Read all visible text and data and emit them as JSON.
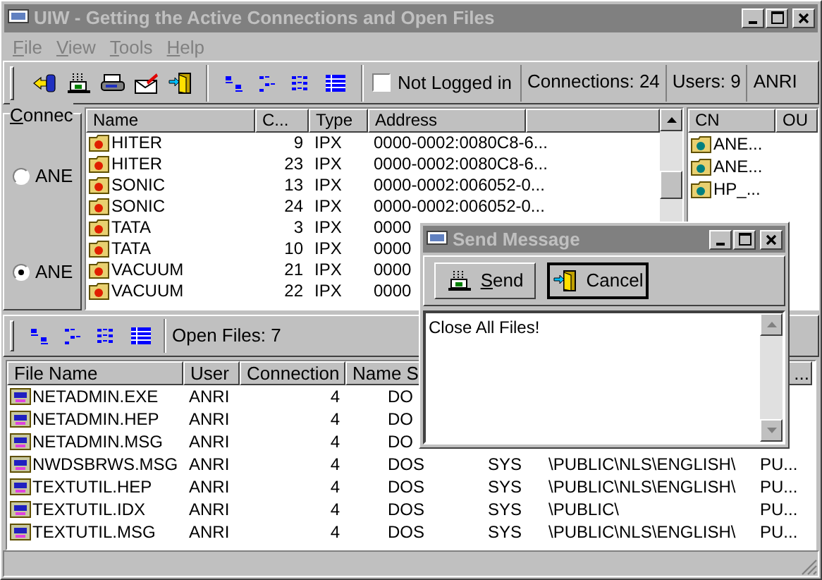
{
  "window": {
    "title": "UIW - Getting the Active Connections and Open Files"
  },
  "menu": [
    {
      "label": "File",
      "disabled": true
    },
    {
      "label": "View",
      "disabled": true
    },
    {
      "label": "Tools",
      "disabled": true
    },
    {
      "label": "Help",
      "disabled": true
    }
  ],
  "toolbar": {
    "not_logged_in": {
      "label": "Not Logged in",
      "checked": false
    },
    "panels": [
      "Connections: 24",
      "Users: 9",
      "ANRI"
    ]
  },
  "connection_group": {
    "label": "Connec",
    "options": [
      {
        "label": "ANE",
        "selected": false
      },
      {
        "label": "ANE",
        "selected": true
      }
    ]
  },
  "connections": {
    "columns": [
      "Name",
      "C...",
      "Type",
      "Address"
    ],
    "rows": [
      {
        "name": "HITER",
        "c": "9",
        "type": "IPX",
        "address": "0000-0002:0080C8-6..."
      },
      {
        "name": "HITER",
        "c": "23",
        "type": "IPX",
        "address": "0000-0002:0080C8-6..."
      },
      {
        "name": "SONIC",
        "c": "13",
        "type": "IPX",
        "address": "0000-0002:006052-0..."
      },
      {
        "name": "SONIC",
        "c": "24",
        "type": "IPX",
        "address": "0000-0002:006052-0..."
      },
      {
        "name": "TATA",
        "c": "3",
        "type": "IPX",
        "address": "0000"
      },
      {
        "name": "TATA",
        "c": "10",
        "type": "IPX",
        "address": "0000"
      },
      {
        "name": "VACUUM",
        "c": "21",
        "type": "IPX",
        "address": "0000"
      },
      {
        "name": "VACUUM",
        "c": "22",
        "type": "IPX",
        "address": "0000"
      }
    ]
  },
  "objects": {
    "columns": [
      "CN",
      "OU"
    ],
    "items": [
      "ANE...",
      "ANE...",
      "HP_..."
    ]
  },
  "files_toolbar": {
    "label": "Open Files: 7"
  },
  "files": {
    "columns": [
      "File Name",
      "User",
      "Connection",
      "Name S",
      "..."
    ],
    "rows": [
      {
        "file": "NETADMIN.EXE",
        "user": "ANRI",
        "connection": "4",
        "name_space": "DO"
      },
      {
        "file": "NETADMIN.HEP",
        "user": "ANRI",
        "connection": "4",
        "name_space": "DO"
      },
      {
        "file": "NETADMIN.MSG",
        "user": "ANRI",
        "connection": "4",
        "name_space": "DO"
      },
      {
        "file": "NWDSBRWS.MSG",
        "user": "ANRI",
        "connection": "4",
        "name_space": "DOS",
        "volume": "SYS",
        "path": "\\PUBLIC\\NLS\\ENGLISH\\",
        "column_7": "PU..."
      },
      {
        "file": "TEXTUTIL.HEP",
        "user": "ANRI",
        "connection": "4",
        "name_space": "DOS",
        "volume": "SYS",
        "path": "\\PUBLIC\\NLS\\ENGLISH\\",
        "column_7": "PU..."
      },
      {
        "file": "TEXTUTIL.IDX",
        "user": "ANRI",
        "connection": "4",
        "name_space": "DOS",
        "volume": "SYS",
        "path": "\\PUBLIC\\",
        "column_7": "PU..."
      },
      {
        "file": "TEXTUTIL.MSG",
        "user": "ANRI",
        "connection": "4",
        "name_space": "DOS",
        "volume": "SYS",
        "path": "\\PUBLIC\\NLS\\ENGLISH\\",
        "column_7": "PU..."
      }
    ]
  },
  "dialog": {
    "title": "Send Message",
    "buttons": [
      {
        "label": "Send",
        "kind": "send",
        "default": false
      },
      {
        "label": "Cancel",
        "kind": "cancel",
        "default": true
      }
    ],
    "message": "Close All Files!"
  }
}
